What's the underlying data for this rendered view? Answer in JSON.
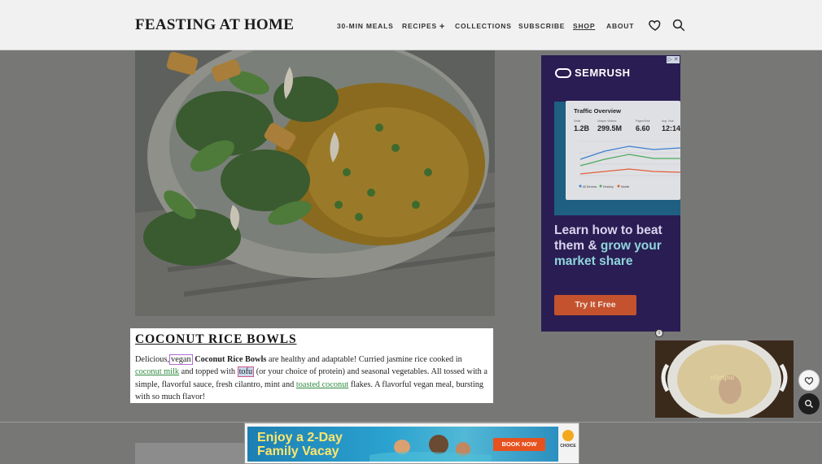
{
  "header": {
    "logo": "FEASTING AT HOME",
    "nav": [
      {
        "label": "30-MIN MEALS"
      },
      {
        "label": "RECIPES"
      },
      {
        "label": "COLLECTIONS"
      },
      {
        "label": "SUBSCRIBE"
      },
      {
        "label": "SHOP"
      },
      {
        "label": "ABOUT"
      }
    ],
    "recipes_expand": "+",
    "icons": [
      "heart-icon",
      "search-icon"
    ]
  },
  "popup": {
    "title": "COCONUT RICE BOWLS",
    "t1": "Delicious,",
    "vegan": "vegan",
    "recipe_name": "Coconut Rice Bowls",
    "t2": " are healthy and adaptable!  Curried jasmine rice cooked in ",
    "link_coconut_milk": "coconut milk",
    "t3": " and topped with ",
    "tofu": "tofu",
    "t4": " (or your choice of protein) and seasonal vegetables.  All tossed with a simple, flavorful sauce, fresh cilantro, mint and ",
    "link_toasted_coconut": "toasted coconut",
    "t5": " flakes. A flavorful vegan meal, bursting with so much flavor!"
  },
  "ad_right": {
    "brand": "SEMRUSH",
    "card_title": "Traffic Overview",
    "stats": [
      {
        "label": "Visits",
        "value": "1.2B"
      },
      {
        "label": "Unique Visitors",
        "value": "299.5M"
      },
      {
        "label": "Pages/Visit",
        "value": "6.60"
      },
      {
        "label": "Avg. Visit",
        "value": "12:14"
      }
    ],
    "legend": [
      "All Devices",
      "Desktop",
      "Mobile"
    ],
    "headline_plain": "Learn how to beat them &",
    "headline_accent": "grow your market share",
    "cta": "Try It Free",
    "close_label": "▷ ✕",
    "colors": {
      "bg": "#2a1d53",
      "cta": "#c4522e",
      "accent": "#8fd6dc"
    }
  },
  "ad_info_icon": "i",
  "video": {
    "label": "olympia"
  },
  "ad_bottom": {
    "headline_line1": "Enjoy a 2-Day",
    "headline_line2": "Family Vacay",
    "cta": "BOOK NOW",
    "logo_text": "CHOICE"
  }
}
